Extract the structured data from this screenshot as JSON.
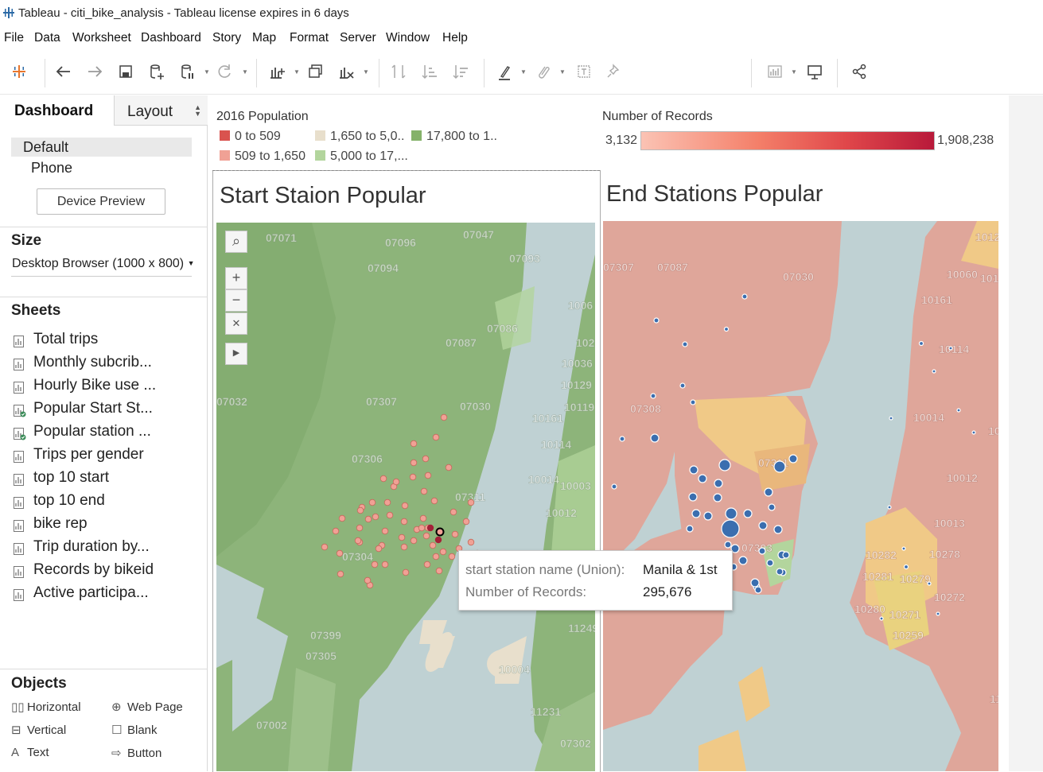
{
  "window": {
    "title": "Tableau - citi_bike_analysis - Tableau license expires in 6 days"
  },
  "menu": [
    "File",
    "Data",
    "Worksheet",
    "Dashboard",
    "Story",
    "Map",
    "Format",
    "Server",
    "Window",
    "Help"
  ],
  "toolbar": {
    "icons": [
      "tableau-logo-icon",
      "back-icon",
      "forward-icon",
      "save-icon",
      "new-data-source-icon",
      "pause-updates-icon",
      "refresh-icon",
      "new-worksheet-icon",
      "duplicate-icon",
      "clear-sheet-icon",
      "swap-icon",
      "sort-ascending-icon",
      "sort-descending-icon",
      "highlight-icon",
      "group-icon",
      "labels-icon",
      "pin-icon",
      "show-me-icon",
      "presentation-icon",
      "share-icon"
    ]
  },
  "left_pane": {
    "tab_dashboard": "Dashboard",
    "tab_layout": "Layout",
    "devices": {
      "default": "Default",
      "phone": "Phone"
    },
    "device_preview_button": "Device Preview",
    "size_heading": "Size",
    "size_value": "Desktop Browser (1000 x 800)",
    "sheets_heading": "Sheets",
    "sheets": [
      {
        "label": "Total trips",
        "icon": "bar-chart-icon"
      },
      {
        "label": "Monthly subcrib...",
        "icon": "bar-chart-icon"
      },
      {
        "label": "Hourly Bike use ...",
        "icon": "bar-chart-icon"
      },
      {
        "label": "Popular Start St...",
        "icon": "map-sheet-used-icon"
      },
      {
        "label": "Popular station ...",
        "icon": "map-sheet-used-icon"
      },
      {
        "label": "Trips per gender",
        "icon": "bar-chart-icon"
      },
      {
        "label": "top 10 start",
        "icon": "bar-chart-icon"
      },
      {
        "label": "top 10 end",
        "icon": "bar-chart-icon"
      },
      {
        "label": "bike rep",
        "icon": "bar-chart-icon"
      },
      {
        "label": "Trip duration by...",
        "icon": "bar-chart-icon"
      },
      {
        "label": "Records by bikeid",
        "icon": "bar-chart-icon"
      },
      {
        "label": "Active participa...",
        "icon": "bar-chart-icon"
      }
    ],
    "objects_heading": "Objects",
    "objects": {
      "horizontal": "Horizontal",
      "web_page": "Web Page",
      "vertical": "Vertical",
      "blank": "Blank",
      "text": "Text",
      "button": "Button"
    }
  },
  "legend_population": {
    "title": "2016 Population",
    "items": [
      {
        "label": "0 to 509",
        "color": "#d9534f"
      },
      {
        "label": "1,650 to 5,0..",
        "color": "#e8dfcc"
      },
      {
        "label": "17,800 to 1..",
        "color": "#85b26a"
      },
      {
        "label": "509 to 1,650",
        "color": "#f0a195"
      },
      {
        "label": "5,000 to 17,...",
        "color": "#b3d59d"
      }
    ]
  },
  "legend_records": {
    "title": "Number of Records",
    "min": "3,132",
    "max": "1,908,238"
  },
  "zones": {
    "start_title": "Start Staion Popular",
    "end_title": "End Stations Popular"
  },
  "zip_labels_start": [
    "07071",
    "07096",
    "07047",
    "07093",
    "07094",
    "07086",
    "07087",
    "07307",
    "07030",
    "07032",
    "07306",
    "07304",
    "07302",
    "07311",
    "07399",
    "07305",
    "07002",
    "10036",
    "10119",
    "10161",
    "10114",
    "10014",
    "10003",
    "10012",
    "10004",
    "11249",
    "11231",
    "1006",
    "102",
    "10129"
  ],
  "zip_labels_end": [
    "07307",
    "07087",
    "07030",
    "10060",
    "10161",
    "10114",
    "10014",
    "07308",
    "07311",
    "07303",
    "10012",
    "10013",
    "10282",
    "10278",
    "10281",
    "10279",
    "10272",
    "10280",
    "10271",
    "10259",
    "1012",
    "101",
    "100",
    "11"
  ],
  "tooltip": {
    "row1_key": "start station name (Union):",
    "row1_value": "Manila & 1st",
    "row2_key": "Number of Records:",
    "row2_value": "295,676"
  },
  "colors": {
    "start_map_land": "#8db47a",
    "end_map_land": "#dfa69a",
    "water": "#bfd1d3",
    "start_marker": "#f0a195",
    "end_marker": "#3b6eaf"
  }
}
